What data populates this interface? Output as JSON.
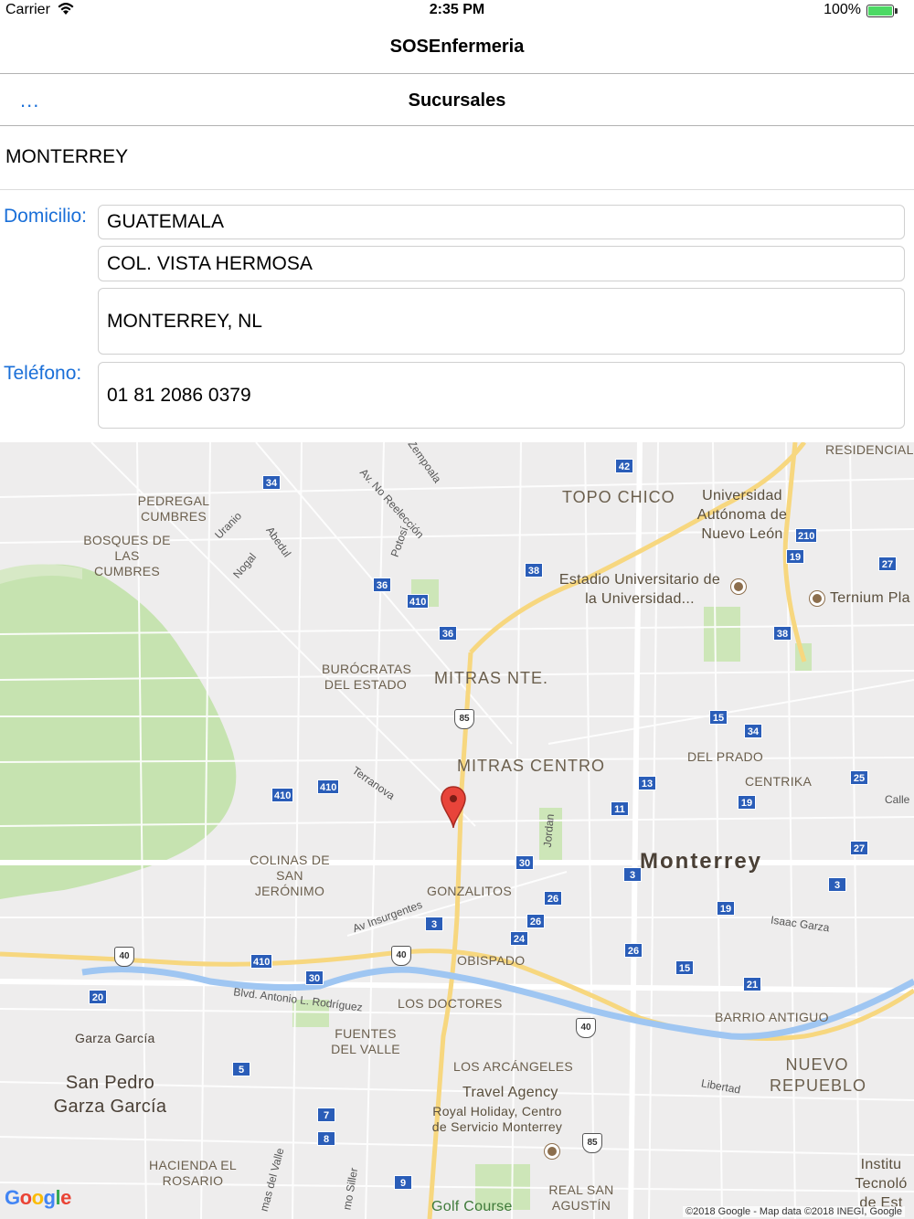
{
  "status_bar": {
    "carrier": "Carrier",
    "time": "2:35 PM",
    "battery": "100%"
  },
  "app": {
    "title": "SOSEnfermeria"
  },
  "nav": {
    "back_label": "...",
    "title": "Sucursales"
  },
  "branch": {
    "name": "MONTERREY"
  },
  "form": {
    "address_label": "Domicilio:",
    "address_line1": "GUATEMALA",
    "address_line2": "COL. VISTA HERMOSA",
    "address_line3": "MONTERREY, NL",
    "phone_label": "Teléfono:",
    "phone": "01 81 2086 0379"
  },
  "map": {
    "places": {
      "residencial_nova": "RESIDENCIAL NOVA",
      "pedregal_cumbres": "PEDREGAL CUMBRES",
      "bosques_cumbres": "BOSQUES DE LAS CUMBRES",
      "topo_chico": "TOPO CHICO",
      "uanl": "Universidad Autónoma de Nuevo León",
      "estadio": "Estadio Universitario de la Universidad...",
      "ternium": "Ternium Pla",
      "burocratas": "BURÓCRATAS DEL ESTADO",
      "mitras_nte": "MITRAS NTE.",
      "mitras_centro": "MITRAS CENTRO",
      "del_prado": "DEL PRADO",
      "centrika": "CENTRIKA",
      "monterrey": "Monterrey",
      "colinas": "COLINAS DE SAN JERÓNIMO",
      "gonzalitos": "GONZALITOS",
      "obispado": "OBISPADO",
      "los_doctores": "LOS DOCTORES",
      "barrio_antiguo": "BARRIO ANTIGUO",
      "garza_garcia": "Garza García",
      "fuentes_valle": "FUENTES DEL VALLE",
      "los_arcangeles": "LOS ARCÁNGELES",
      "travel_agency": "Travel Agency",
      "royal_holiday": "Royal Holiday, Centro de Servicio Monterrey",
      "nuevo_repueblo": "NUEVO REPUEBLO",
      "san_pedro": "San Pedro Garza García",
      "hacienda_rosario": "HACIENDA EL ROSARIO",
      "real_san_agustin": "REAL SAN AGUSTÍN",
      "golf_course": "Golf Course",
      "instituto": "Institu Tecnoló de Est"
    },
    "streets": {
      "zempoala": "e Zempoala",
      "no_reeleccion": "Av. No Reelección",
      "uranio": "Uranio",
      "abedul": "Abedul",
      "nogal": "Nogal",
      "potosi": "Potosí",
      "terranova": "Terranova",
      "jordan": "Jordan",
      "insurgentes": "Av Insurgentes",
      "isaac_garza": "Isaac Garza",
      "antonio_rodriguez": "Blvd. Antonio L. Rodríguez",
      "libertad": "Libertad",
      "calle": "Calle",
      "del_valle": "mas del Valle",
      "siller": "mo Siller"
    },
    "route_shields": {
      "s42": "42",
      "s34a": "34",
      "s210": "210",
      "s19a": "19",
      "s27a": "27",
      "s38a": "38",
      "s36a": "36",
      "s410a": "410",
      "s36b": "36",
      "s38b": "38",
      "s15a": "15",
      "s34b": "34",
      "s13": "13",
      "s25": "25",
      "s410b": "410",
      "s410c": "410",
      "s11": "11",
      "s19b": "19",
      "s27b": "27",
      "s30a": "30",
      "s3a": "3",
      "s3b": "3",
      "s26a": "26",
      "s19c": "19",
      "s26b": "26",
      "s3c": "3",
      "s24": "24",
      "s26c": "26",
      "s15b": "15",
      "s21": "21",
      "s410d": "410",
      "s30b": "30",
      "s20": "20",
      "s5": "5",
      "s7": "7",
      "s8": "8",
      "s9": "9"
    },
    "interstates": {
      "i85a": "85",
      "i40a": "40",
      "i40b": "40",
      "i40c": "40",
      "i85b": "85"
    },
    "logo": "Google",
    "copyright": "©2018 Google - Map data ©2018 INEGI, Google"
  }
}
